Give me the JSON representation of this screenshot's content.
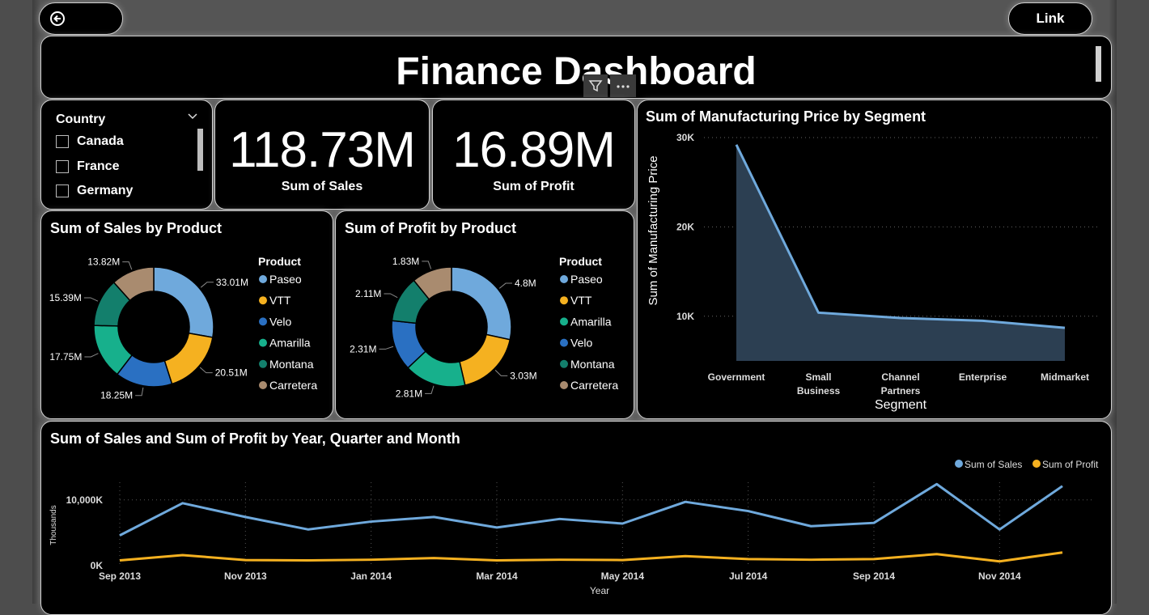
{
  "header": {
    "title": "Finance Dashboard",
    "link_label": "Link"
  },
  "slicer": {
    "title": "Country",
    "items": [
      "Canada",
      "France",
      "Germany"
    ]
  },
  "kpis": [
    {
      "value": "118.73M",
      "label": "Sum of  Sales"
    },
    {
      "value": "16.89M",
      "label": "Sum of Profit"
    }
  ],
  "colors": {
    "Paseo": "#6fa9dc",
    "VTT": "#f5b120",
    "Velo": "#2a70c2",
    "Amarilla": "#17b08c",
    "Montana": "#137f6c",
    "Carretera": "#a98b6f",
    "area_line": "#6fa9dc",
    "area_fill": "#2c3f52",
    "sales": "#6fa9dc",
    "profit": "#f5b120"
  },
  "chart_data": [
    {
      "type": "pie",
      "title": "Sum of Sales by Product",
      "legend_title": "Product",
      "legend_placement": "right",
      "legend": [
        "Paseo",
        "VTT",
        "Velo",
        "Amarilla",
        "Montana",
        "Carretera"
      ],
      "slices": [
        {
          "name": "Paseo",
          "value": 33.01,
          "label": "33.01M"
        },
        {
          "name": "VTT",
          "value": 20.51,
          "label": "20.51M"
        },
        {
          "name": "Velo",
          "value": 18.25,
          "label": "18.25M"
        },
        {
          "name": "Amarilla",
          "value": 17.75,
          "label": "17.75M"
        },
        {
          "name": "Montana",
          "value": 15.39,
          "label": "15.39M"
        },
        {
          "name": "Carretera",
          "value": 13.82,
          "label": "13.82M"
        }
      ]
    },
    {
      "type": "pie",
      "title": "Sum of Profit by Product",
      "legend_title": "Product",
      "legend_placement": "right",
      "legend": [
        "Paseo",
        "VTT",
        "Amarilla",
        "Velo",
        "Montana",
        "Carretera"
      ],
      "slices": [
        {
          "name": "Paseo",
          "value": 4.8,
          "label": "4.8M"
        },
        {
          "name": "VTT",
          "value": 3.03,
          "label": "3.03M"
        },
        {
          "name": "Amarilla",
          "value": 2.81,
          "label": "2.81M"
        },
        {
          "name": "Velo",
          "value": 2.31,
          "label": "2.31M"
        },
        {
          "name": "Montana",
          "value": 2.11,
          "label": "2.11M"
        },
        {
          "name": "Carretera",
          "value": 1.83,
          "label": "1.83M"
        }
      ]
    },
    {
      "type": "area",
      "title": "Sum of Manufacturing Price by Segment",
      "xlabel": "Segment",
      "ylabel": "Sum of Manufacturing Price",
      "categories": [
        "Government",
        "Small Business",
        "Channel Partners",
        "Enterprise",
        "Midmarket"
      ],
      "values": [
        29200,
        10400,
        9800,
        9500,
        8700
      ],
      "ylim": [
        5000,
        30000
      ],
      "yticks": [
        10000,
        20000,
        30000
      ],
      "ytick_labels": [
        "10K",
        "20K",
        "30K"
      ]
    },
    {
      "type": "line",
      "title": "Sum of Sales and Sum of Profit by Year, Quarter and Month",
      "xlabel": "Year",
      "ylabel": "Thousands",
      "legend_placement": "top-right",
      "x": [
        "Sep 2013",
        "Oct 2013",
        "Nov 2013",
        "Dec 2013",
        "Jan 2014",
        "Feb 2014",
        "Mar 2014",
        "Apr 2014",
        "May 2014",
        "Jun 2014",
        "Jul 2014",
        "Aug 2014",
        "Sep 2014",
        "Oct 2014",
        "Nov 2014",
        "Dec 2014"
      ],
      "xtick_labels": [
        {
          "i": 0,
          "label": "Sep 2013"
        },
        {
          "i": 2,
          "label": "Nov 2013"
        },
        {
          "i": 4,
          "label": "Jan 2014"
        },
        {
          "i": 6,
          "label": "Mar 2014"
        },
        {
          "i": 8,
          "label": "May 2014"
        },
        {
          "i": 10,
          "label": "Jul 2014"
        },
        {
          "i": 12,
          "label": "Sep 2014"
        },
        {
          "i": 14,
          "label": "Nov 2014"
        }
      ],
      "ylim": [
        0,
        16000
      ],
      "yticks": [
        0,
        10000
      ],
      "ytick_labels": [
        "0K",
        "10,000K"
      ],
      "series": [
        {
          "name": "Sum of  Sales",
          "values": [
            4600,
            9500,
            7400,
            5500,
            6700,
            7400,
            5800,
            7100,
            6400,
            9700,
            8300,
            6000,
            6500,
            12400,
            5500,
            12100
          ]
        },
        {
          "name": "Sum of Profit",
          "values": [
            800,
            1600,
            850,
            800,
            900,
            1150,
            800,
            900,
            850,
            1450,
            1000,
            900,
            1000,
            1750,
            650,
            2000
          ]
        }
      ]
    }
  ]
}
